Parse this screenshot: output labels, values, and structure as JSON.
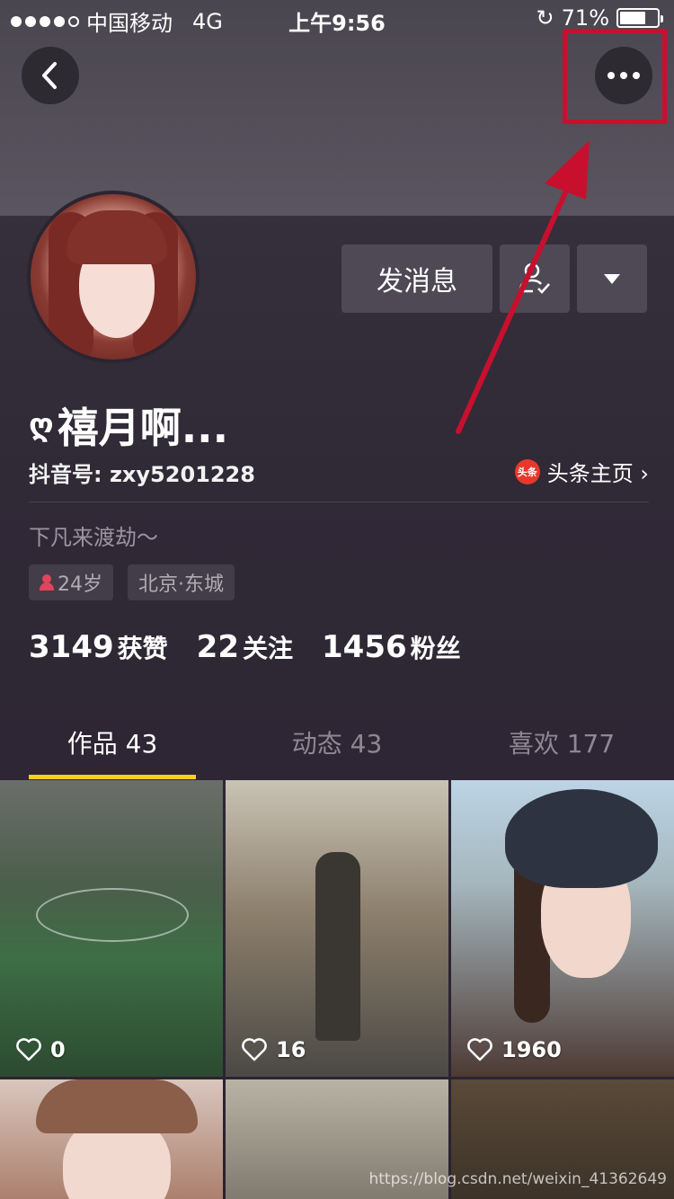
{
  "status_bar": {
    "carrier": "中国移动",
    "network": "4G",
    "time": "上午9:56",
    "battery": "71%",
    "battery_level": 0.71
  },
  "header": {
    "back_icon": "chevron-left-icon",
    "more_icon": "more-horizontal-icon"
  },
  "annotation": {
    "color": "#c8102e"
  },
  "profile": {
    "message_button": "发消息",
    "nickname": "禧月啊...",
    "nickname_prefix": "ღ",
    "douyin_id": "抖音号: zxy5201228",
    "toutiao_icon_text": "头条",
    "toutiao_link": "头条主页 ›",
    "bio": "下凡来渡劫～",
    "age_tag": "24岁",
    "location_tag": "北京·东城"
  },
  "stats": [
    {
      "num": "3149",
      "label": "获赞"
    },
    {
      "num": "22",
      "label": "关注"
    },
    {
      "num": "1456",
      "label": "粉丝"
    }
  ],
  "tabs": [
    {
      "label": "作品 43"
    },
    {
      "label": "动态 43"
    },
    {
      "label": "喜欢 177"
    }
  ],
  "tab_accent": "#facf21",
  "videos": [
    {
      "likes": "0"
    },
    {
      "likes": "16"
    },
    {
      "likes": "1960"
    }
  ],
  "watermark": "https://blog.csdn.net/weixin_41362649"
}
